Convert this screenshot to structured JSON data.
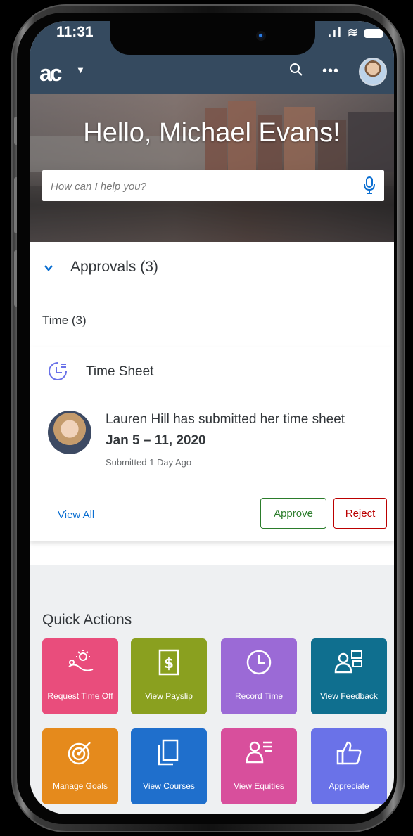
{
  "status": {
    "time": "11:31"
  },
  "header": {
    "logo": "ac"
  },
  "hero": {
    "greeting": "Hello, Michael Evans!"
  },
  "search": {
    "placeholder": "How can I help you?"
  },
  "approvals": {
    "title": "Approvals (3)",
    "time_label": "Time (3)",
    "card": {
      "title": "Time Sheet",
      "message": "Lauren Hill has submitted her time sheet",
      "dates": "Jan 5 – 11, 2020",
      "submitted": "Submitted 1 Day Ago",
      "view_all": "View All",
      "approve": "Approve",
      "reject": "Reject"
    }
  },
  "quick_actions": {
    "title": "Quick Actions",
    "tiles": [
      {
        "label": "Request Time Off",
        "icon": "sun-person-icon",
        "color": "#e94d7c"
      },
      {
        "label": "View Payslip",
        "icon": "payslip-icon",
        "color": "#8aa01f"
      },
      {
        "label": "Record Time",
        "icon": "clock-icon",
        "color": "#9b6ad6"
      },
      {
        "label": "View Feedback",
        "icon": "feedback-icon",
        "color": "#0f6f8f"
      },
      {
        "label": "Manage Goals",
        "icon": "target-icon",
        "color": "#e58a1c"
      },
      {
        "label": "View Courses",
        "icon": "book-icon",
        "color": "#1f6fcc"
      },
      {
        "label": "View Equities",
        "icon": "person-list-icon",
        "color": "#d84f9c"
      },
      {
        "label": "Appreciate",
        "icon": "thumbs-up-icon",
        "color": "#6a72e8"
      }
    ]
  }
}
